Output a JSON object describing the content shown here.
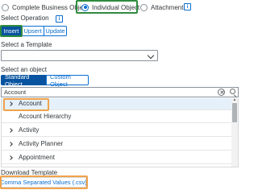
{
  "operation_types": {
    "options": [
      "Complete Business Object",
      "Individual Object",
      "Attachment"
    ],
    "selected": "Individual Object"
  },
  "select_operation": {
    "label": "Select Operation",
    "info_icon": "info-icon",
    "buttons": [
      "Insert",
      "Upsert",
      "Update"
    ],
    "selected": "Insert"
  },
  "template": {
    "label": "Select a Template",
    "value": ""
  },
  "object": {
    "label": "Select an object",
    "tabs": [
      "Standard Object",
      "Custom Object"
    ],
    "selected_tab": "Standard Object",
    "search_value": "Account",
    "items": [
      {
        "label": "Account",
        "expandable": true,
        "selected": true
      },
      {
        "label": "Account Hierarchy",
        "expandable": false,
        "selected": false
      },
      {
        "label": "Activity",
        "expandable": true,
        "selected": false
      },
      {
        "label": "Activity Planner",
        "expandable": true,
        "selected": false
      },
      {
        "label": "Appointment",
        "expandable": true,
        "selected": false
      }
    ]
  },
  "download": {
    "label": "Download Template",
    "button": "Comma Separated Values (.csv)"
  },
  "colors": {
    "accent": "#0a6ed1",
    "selected_button": "#0854a0",
    "highlight_green": "#2e8b3d",
    "highlight_orange": "#f0a24b"
  }
}
